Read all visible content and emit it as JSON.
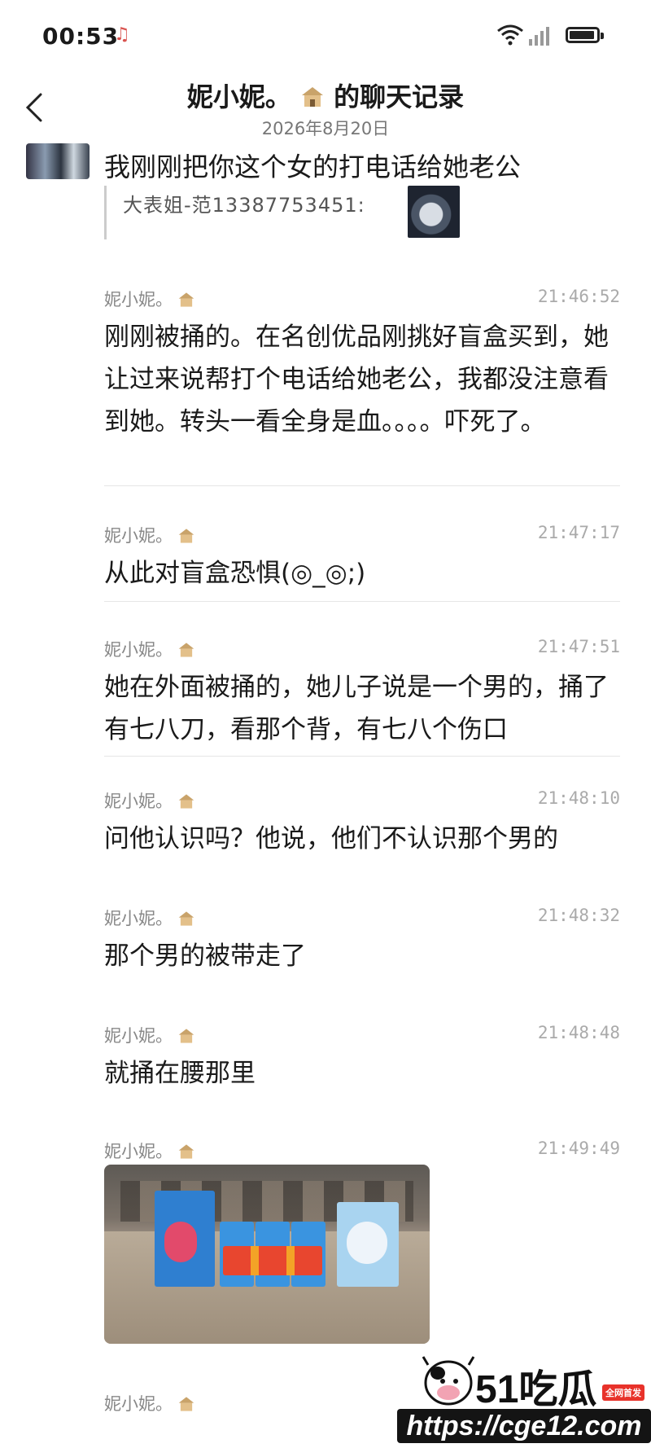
{
  "status_bar": {
    "time": "00:53",
    "music_icon": "♫"
  },
  "header": {
    "title_prefix": "妮小妮。",
    "title_suffix": "的聊天记录",
    "date": "2026年8月20日"
  },
  "first_message": {
    "text": "我刚刚把你这个女的打电话给她老公",
    "quote_text": "大表姐-范13387753451:"
  },
  "records": [
    {
      "sender": "妮小妮。",
      "time": "21:46:52",
      "text": "刚刚被捅的。在名创优品刚挑好盲盒买到，她让过来说帮打个电话给她老公，我都没注意看到她。转头一看全身是血。。。。吓死了。"
    },
    {
      "sender": "妮小妮。",
      "time": "21:47:17",
      "text": "从此对盲盒恐惧(◎_◎;)"
    },
    {
      "sender": "妮小妮。",
      "time": "21:47:51",
      "text": "她在外面被捅的，她儿子说是一个男的，捅了有七八刀，看那个背，有七八个伤口"
    },
    {
      "sender": "妮小妮。",
      "time": "21:48:10",
      "text": "问他认识吗？他说，他们不认识那个男的"
    },
    {
      "sender": "妮小妮。",
      "time": "21:48:32",
      "text": "那个男的被带走了"
    },
    {
      "sender": "妮小妮。",
      "time": "21:48:48",
      "text": "就捅在腰那里"
    },
    {
      "sender": "妮小妮。",
      "time": "21:49:49",
      "text": ""
    },
    {
      "sender": "妮小妮。",
      "time": "",
      "text": ""
    }
  ],
  "watermark": {
    "logo_num": "51",
    "logo_text": "吃瓜",
    "badge": "全网首发",
    "url": "https://cge12.com"
  }
}
